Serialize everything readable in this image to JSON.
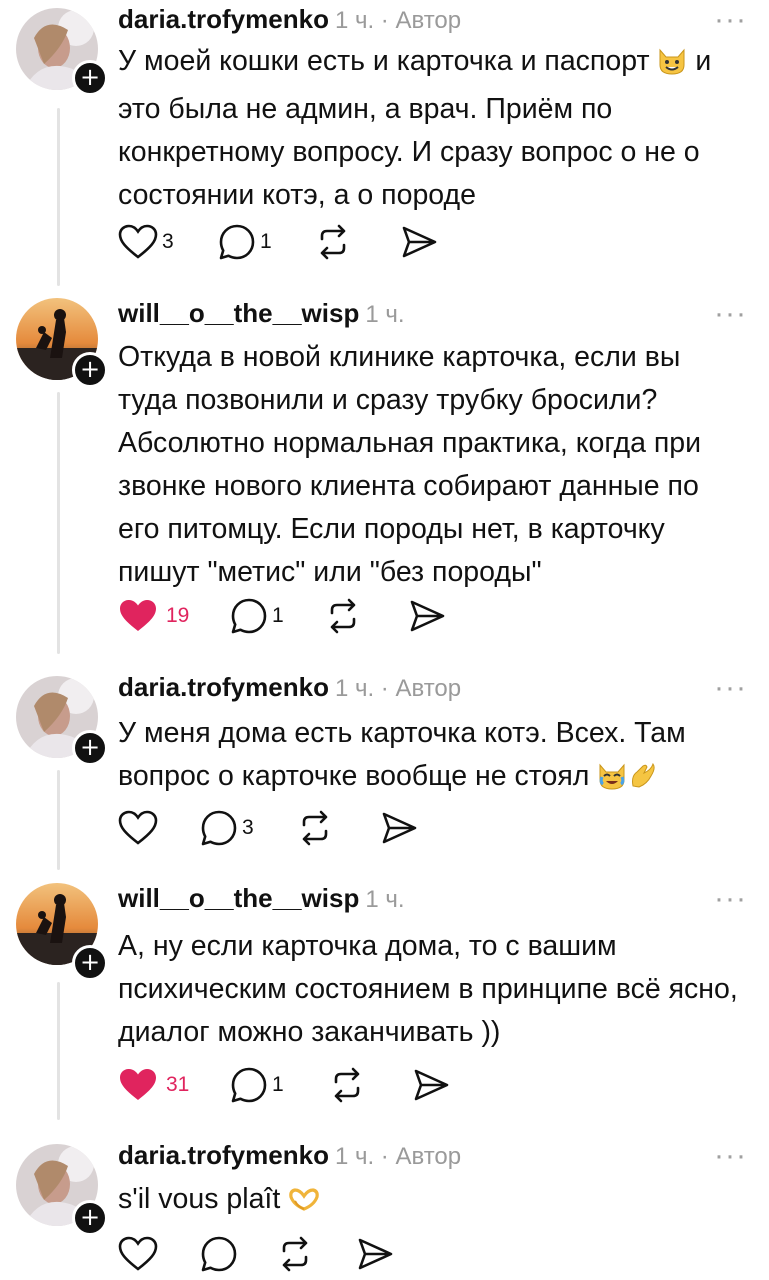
{
  "posts": [
    {
      "username": "daria.trofymenko",
      "meta": "1 ч. · Автор",
      "text_parts": [
        "У моей кошки есть и карточка и паспорт ",
        " и это была не админ, а врач. Приём по конкретному вопросу. И сразу вопрос о не о состоянии котэ, а о породе"
      ],
      "emoji": "grinning-cat-emoji",
      "likes": "3",
      "liked": false,
      "replies": "1"
    },
    {
      "username": "will__o__the__wisp",
      "meta": "1 ч.",
      "text": "Откуда в новой клинике карточка, если вы туда позвонили и сразу трубку бросили? Абсолютно нормальная практика, когда при звонке нового клиента собирают данные по его питомцу. Если породы нет, в карточку пишут \"метис\" или \"без породы\"",
      "likes": "19",
      "liked": true,
      "replies": "1"
    },
    {
      "username": "daria.trofymenko",
      "meta": "1 ч. · Автор",
      "text": "У меня дома есть карточка котэ. Всех. Там вопрос о карточке вообще не стоял ",
      "emoji": [
        "crying-cat-emoji",
        "pinching-hand-emoji"
      ],
      "likes": "",
      "liked": false,
      "replies": "3"
    },
    {
      "username": "will__o__the__wisp",
      "meta": "1 ч.",
      "text": "А, ну если карточка дома, то с вашим психическим состоянием в принципе всё ясно, диалог можно заканчивать ))",
      "likes": "31",
      "liked": true,
      "replies": "1"
    },
    {
      "username": "daria.trofymenko",
      "meta": "1 ч. · Автор",
      "text": "s'il vous plaît ",
      "emoji": "heart-hands-emoji",
      "likes": "",
      "liked": false,
      "replies": ""
    }
  ],
  "colors": {
    "like_red": "#e0245e",
    "muted": "#9a9a9a",
    "text": "#111111"
  }
}
